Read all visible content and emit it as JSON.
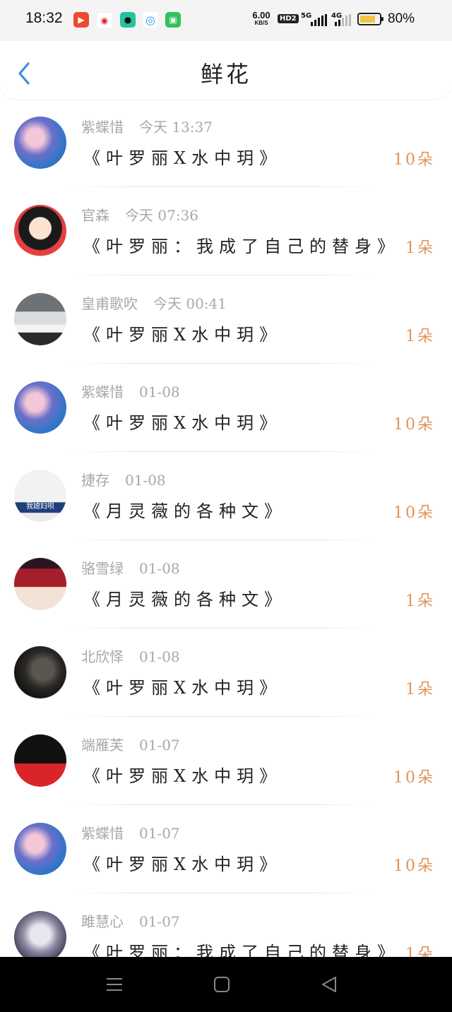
{
  "status_bar": {
    "time": "18:32",
    "net_speed_value": "6.00",
    "net_speed_unit": "KB/S",
    "hd_badge": "HD2",
    "sim1_label": "5G",
    "sim2_label": "4G",
    "battery_percent": "80%",
    "battery_level": 0.8,
    "app_icons": [
      "video-app-icon",
      "weibo-icon",
      "qq-icon",
      "mobile-carrier-icon",
      "wechat-icon"
    ]
  },
  "header": {
    "title": "鲜花",
    "back_icon": "chevron-left-icon",
    "accent_color": "#3d8fe0"
  },
  "colors": {
    "count_color": "#e0945a",
    "meta_color": "#a8a8a8"
  },
  "items": [
    {
      "user": "紫蝶惜",
      "time": "今天 13:37",
      "work": "《叶罗丽X水中玥》",
      "count": "10朵"
    },
    {
      "user": "官森",
      "time": "今天 07:36",
      "work": "《叶罗丽：我成了自己的替身》",
      "count": "1朵"
    },
    {
      "user": "皇甫歌吹",
      "time": "今天 00:41",
      "work": "《叶罗丽X水中玥》",
      "count": "1朵"
    },
    {
      "user": "紫蝶惜",
      "time": "01-08",
      "work": "《叶罗丽X水中玥》",
      "count": "10朵"
    },
    {
      "user": "捷存",
      "time": "01-08",
      "work": "《月灵薇的各种文》",
      "count": "10朵",
      "avatar_caption": "我媳妇呗"
    },
    {
      "user": "骆雪绿",
      "time": "01-08",
      "work": "《月灵薇的各种文》",
      "count": "1朵"
    },
    {
      "user": "北欣怿",
      "time": "01-08",
      "work": "《叶罗丽X水中玥》",
      "count": "1朵"
    },
    {
      "user": "端雁芙",
      "time": "01-07",
      "work": "《叶罗丽X水中玥》",
      "count": "10朵"
    },
    {
      "user": "紫蝶惜",
      "time": "01-07",
      "work": "《叶罗丽X水中玥》",
      "count": "10朵"
    },
    {
      "user": "雎慧心",
      "time": "01-07",
      "work": "《叶罗丽：我成了自己的替身》",
      "count": "1朵"
    }
  ],
  "nav_bar": {
    "icons": [
      "menu-icon",
      "home-icon",
      "back-triangle-icon"
    ]
  }
}
